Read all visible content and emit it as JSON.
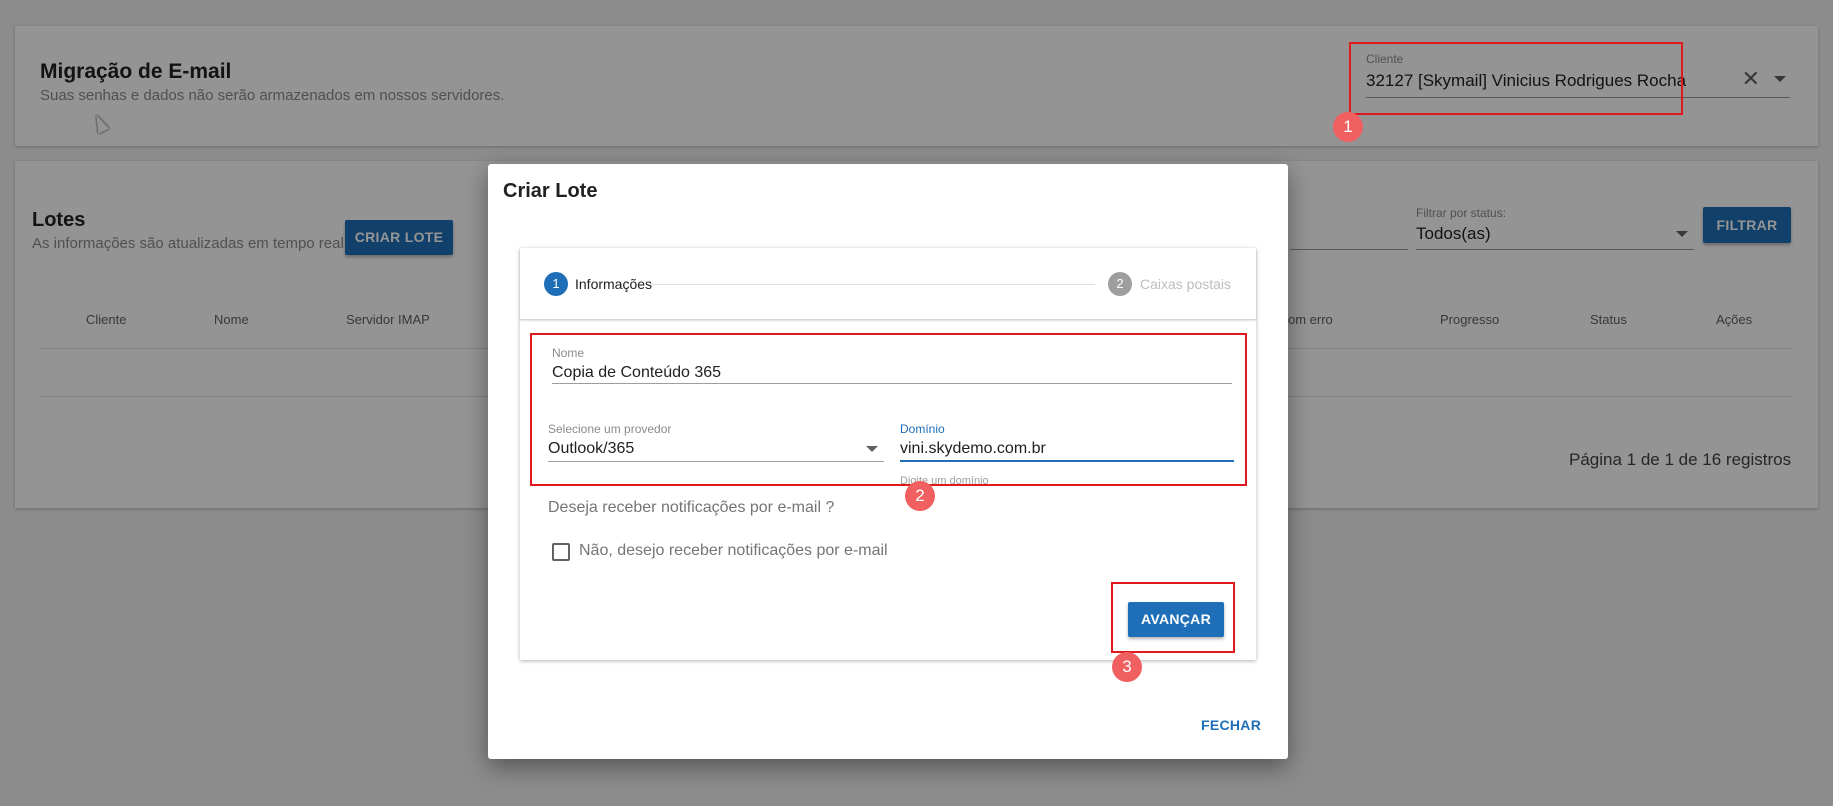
{
  "header": {
    "title": "Migração de E-mail",
    "subtitle": "Suas senhas e dados não serão armazenados em nossos servidores.",
    "client_label": "Cliente",
    "client_value": "32127 [Skymail] Vinicius Rodrigues Rocha"
  },
  "lots": {
    "title": "Lotes",
    "subtitle": "As informações são atualizadas em tempo real",
    "create_button": "CRIAR LOTE",
    "status_filter_label": "Filtrar por status:",
    "status_filter_value": "Todos(as)",
    "filter_button": "FILTRAR",
    "columns": [
      "Cliente",
      "Nome",
      "Servidor IMAP",
      "om erro",
      "Progresso",
      "Status",
      "Ações"
    ],
    "pagination": "Página 1 de 1 de 16 registros"
  },
  "modal": {
    "title": "Criar Lote",
    "steps": [
      {
        "number": "1",
        "label": "Informações"
      },
      {
        "number": "2",
        "label": "Caixas postais"
      }
    ],
    "name_label": "Nome",
    "name_value": "Copia de Conteúdo 365",
    "provider_label": "Selecione um provedor",
    "provider_value": "Outlook/365",
    "domain_label": "Domínio",
    "domain_value": "vini.skydemo.com.br",
    "domain_hint": "Digite um domínio",
    "notification_question": "Deseja receber notificações por e-mail ?",
    "notification_checkbox_label": "Não, desejo receber notificações por e-mail",
    "advance_button": "AVANÇAR",
    "close_button": "FECHAR"
  },
  "annotations": {
    "badge_1": "1",
    "badge_2": "2",
    "badge_3": "3",
    "color": "#e0191f"
  },
  "colors": {
    "primary": "#1e6fb8",
    "annotation_badge": "#f06060"
  }
}
